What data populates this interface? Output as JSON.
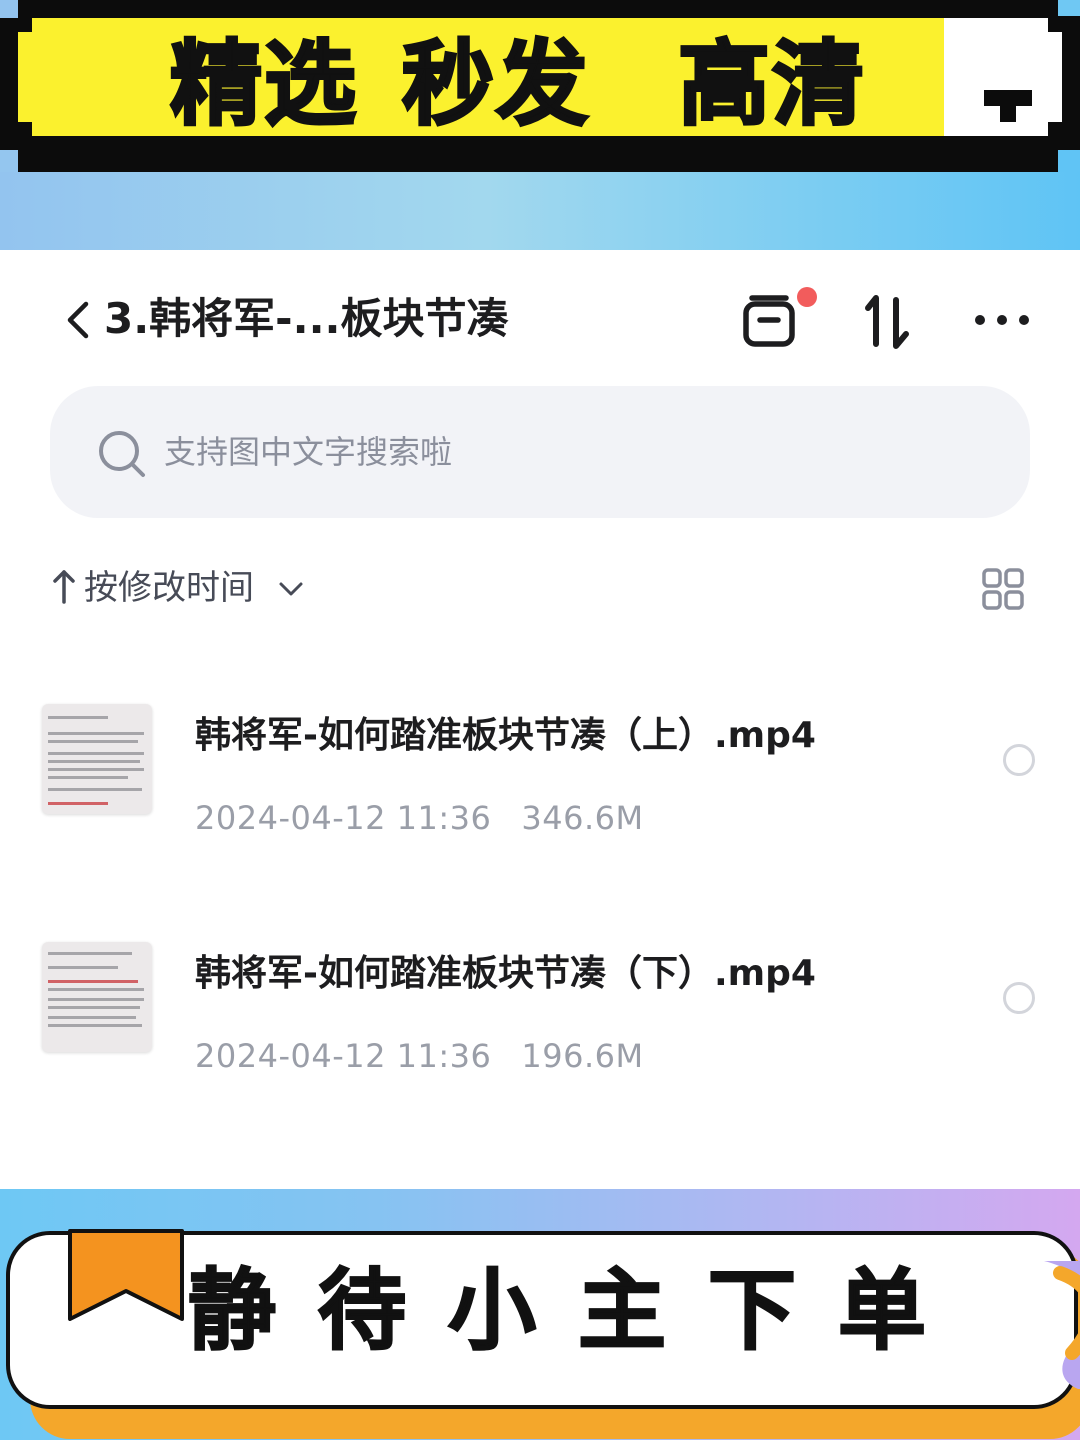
{
  "top_banner": {
    "words": [
      "精选",
      "秒发",
      "高清"
    ]
  },
  "nav": {
    "title": "3.韩将军-...板块节凑"
  },
  "search": {
    "placeholder": "支持图中文字搜索啦"
  },
  "sort": {
    "label": "按修改时间"
  },
  "files": [
    {
      "name": "韩将军-如何踏准板块节凑（上）.mp4",
      "date": "2024-04-12 11:36",
      "size": "346.6M"
    },
    {
      "name": "韩将军-如何踏准板块节凑（下）.mp4",
      "date": "2024-04-12 11:36",
      "size": "196.6M"
    }
  ],
  "bottom_banner": {
    "text": "静待小主下单"
  },
  "colors": {
    "banner_yellow": "#fbf12e",
    "notification_dot": "#f25c5c",
    "ribbon_orange": "#f4a72b"
  },
  "icons": [
    "back-icon",
    "recent-icon",
    "sort-toggle-icon",
    "more-icon",
    "search-icon",
    "sort-arrow-icon",
    "chevron-down-icon",
    "grid-view-icon"
  ]
}
